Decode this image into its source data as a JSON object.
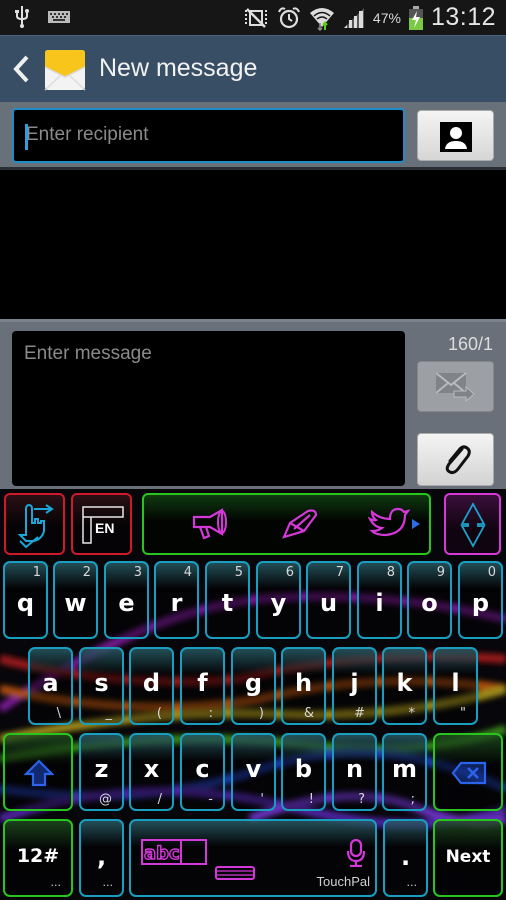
{
  "status_bar": {
    "left_icons": [
      "usb-icon",
      "keyboard-icon"
    ],
    "right_icons": [
      "mute-vibrate-icon",
      "alarm-icon",
      "wifi-icon",
      "signal-icon"
    ],
    "battery_percent": "47%",
    "time": "13:12"
  },
  "action_bar": {
    "title": "New message",
    "back_icon": "chevron-left-icon",
    "app_icon": "envelope-icon"
  },
  "recipient": {
    "placeholder": "Enter recipient",
    "value": ""
  },
  "compose": {
    "placeholder": "Enter message",
    "value": "",
    "counter": "160/1"
  },
  "keyboard": {
    "toolbar": [
      "gesture-icon",
      "language-icon",
      "megaphone-icon",
      "pen-icon",
      "twitter-bird-icon",
      "hide-keyboard-icon"
    ],
    "language_label": "EN",
    "row1": [
      {
        "key": "q",
        "alt": "1"
      },
      {
        "key": "w",
        "alt": "2"
      },
      {
        "key": "e",
        "alt": "3"
      },
      {
        "key": "r",
        "alt": "4"
      },
      {
        "key": "t",
        "alt": "5"
      },
      {
        "key": "y",
        "alt": "6"
      },
      {
        "key": "u",
        "alt": "7"
      },
      {
        "key": "i",
        "alt": "8"
      },
      {
        "key": "o",
        "alt": "9"
      },
      {
        "key": "p",
        "alt": "0"
      }
    ],
    "row2": [
      {
        "key": "a",
        "alt": "\\"
      },
      {
        "key": "s",
        "alt": "_"
      },
      {
        "key": "d",
        "alt": "("
      },
      {
        "key": "f",
        "alt": ":"
      },
      {
        "key": "g",
        "alt": ")"
      },
      {
        "key": "h",
        "alt": "&"
      },
      {
        "key": "j",
        "alt": "#"
      },
      {
        "key": "k",
        "alt": "*"
      },
      {
        "key": "l",
        "alt": "\""
      }
    ],
    "row3": [
      {
        "key": "z",
        "alt": "@"
      },
      {
        "key": "x",
        "alt": "/"
      },
      {
        "key": "c",
        "alt": "-"
      },
      {
        "key": "v",
        "alt": "'"
      },
      {
        "key": "b",
        "alt": "!"
      },
      {
        "key": "n",
        "alt": "?"
      },
      {
        "key": "m",
        "alt": ";"
      }
    ],
    "symbols_label": "12#",
    "comma_label": ",",
    "period_label": ".",
    "more_label": "...",
    "space_brand": "TouchPal",
    "space_mode": "abc",
    "next_label": "Next"
  }
}
